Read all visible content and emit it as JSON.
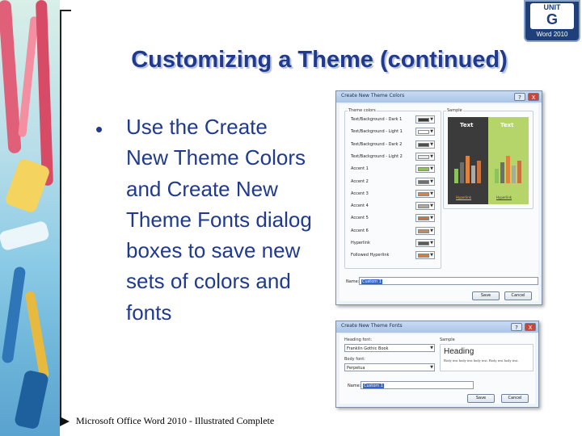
{
  "slide": {
    "title": "Customizing a Theme (continued)",
    "bullet": "Use the Create New Theme Colors and Create New Theme Fonts dialog boxes to save new sets of colors and fonts",
    "footer": "Microsoft Office Word 2010 - Illustrated Complete"
  },
  "badge": {
    "word": "UNIT",
    "letter": "G",
    "product": "Word 2010"
  },
  "colors_dialog": {
    "title": "Create New Theme Colors",
    "help": "?",
    "close": "X",
    "theme_colors_label": "Theme colors",
    "sample_label": "Sample",
    "rows": [
      {
        "label": "Text/Background - Dark 1",
        "color": "#3a3a3a"
      },
      {
        "label": "Text/Background - Light 1",
        "color": "#ffffff"
      },
      {
        "label": "Text/Background - Dark 2",
        "color": "#4d4d4d"
      },
      {
        "label": "Text/Background - Light 2",
        "color": "#e7e9e4"
      },
      {
        "label": "Accent 1",
        "color": "#8ec25c"
      },
      {
        "label": "Accent 2",
        "color": "#6e6e6e"
      },
      {
        "label": "Accent 3",
        "color": "#e0813c"
      },
      {
        "label": "Accent 4",
        "color": "#a9a9a9"
      },
      {
        "label": "Accent 5",
        "color": "#c8733e"
      },
      {
        "label": "Accent 6",
        "color": "#c98a5a"
      },
      {
        "label": "Hyperlink",
        "color": "#5a5a5a"
      },
      {
        "label": "Followed Hyperlink",
        "color": "#e07a2e"
      }
    ],
    "sample_text": "Text",
    "sample_link_1": "Hyperlink",
    "sample_link_2": "Hyperlink",
    "name_label": "Name:",
    "name_value": "Custom 1",
    "save_label": "Save",
    "cancel_label": "Cancel",
    "sample_dark_bg": "#3b3b3b",
    "sample_light_bg": "#b5d56a"
  },
  "fonts_dialog": {
    "title": "Create New Theme Fonts",
    "help": "?",
    "close": "X",
    "heading_font_label": "Heading font:",
    "heading_font_value": "Franklin Gothic Book",
    "body_font_label": "Body font:",
    "body_font_value": "Perpetua",
    "sample_label": "Sample",
    "sample_heading": "Heading",
    "sample_body": "Body text body text body text. Body text body text.",
    "name_label": "Name:",
    "name_value": "Custom 1",
    "save_label": "Save",
    "cancel_label": "Cancel"
  }
}
